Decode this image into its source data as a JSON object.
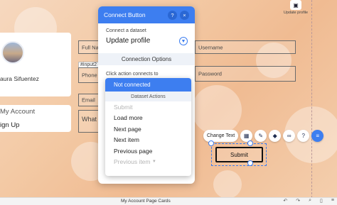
{
  "window_title": "Connect Button",
  "profile": {
    "name": "aura Sifuentez"
  },
  "nav": {
    "my_account": "My Account",
    "sign_up": "ign Up"
  },
  "form": {
    "full_name": "Full Nam",
    "phone": "Phone N",
    "email": "Email",
    "message": "What",
    "username": "Username",
    "password": "Password",
    "input_tag": "#input2"
  },
  "panel": {
    "title": "Connect Button",
    "help": "?",
    "close": "×",
    "dataset_label": "Connect a dataset",
    "dataset_value": "Update profile",
    "section": "Connection Options",
    "click_label": "Click action connects to"
  },
  "dropdown": {
    "selected": "Not connected",
    "group": "Dataset Actions",
    "items": [
      {
        "label": "Submit",
        "disabled": true
      },
      {
        "label": "Load more",
        "disabled": false
      },
      {
        "label": "Next page",
        "disabled": false
      },
      {
        "label": "Next item",
        "disabled": false
      },
      {
        "label": "Previous page",
        "disabled": false
      },
      {
        "label": "Previous item",
        "disabled": true
      }
    ]
  },
  "toolbar": {
    "change_text": "Change Text"
  },
  "submit_button": "Submit",
  "top_right": {
    "label": "Update profile"
  },
  "bottom": {
    "page_name": "My Account Page Cards"
  },
  "colors": {
    "accent": "#3d7ef0"
  }
}
